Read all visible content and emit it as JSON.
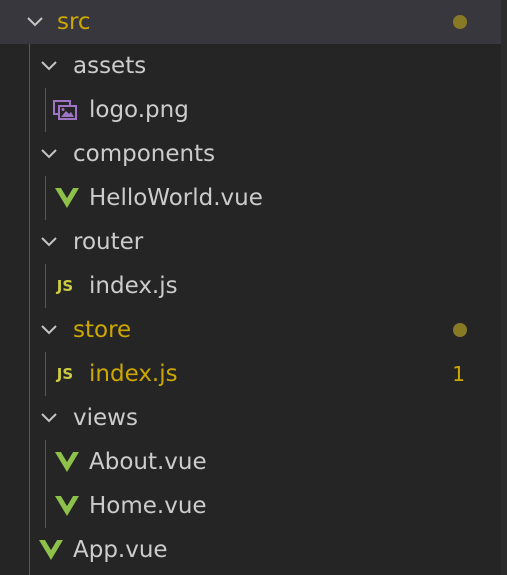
{
  "explorer": {
    "items": [
      {
        "label": "src",
        "type": "folder",
        "depth": 0,
        "modified": true,
        "badge": "",
        "icon": "chevron-down-icon"
      },
      {
        "label": "assets",
        "type": "folder",
        "depth": 1,
        "modified": false,
        "badge": "",
        "icon": "chevron-down-icon"
      },
      {
        "label": "logo.png",
        "type": "file",
        "depth": 2,
        "modified": false,
        "badge": "",
        "icon": "image-file-icon"
      },
      {
        "label": "components",
        "type": "folder",
        "depth": 1,
        "modified": false,
        "badge": "",
        "icon": "chevron-down-icon"
      },
      {
        "label": "HelloWorld.vue",
        "type": "file",
        "depth": 2,
        "modified": false,
        "badge": "",
        "icon": "vue-file-icon"
      },
      {
        "label": "router",
        "type": "folder",
        "depth": 1,
        "modified": false,
        "badge": "",
        "icon": "chevron-down-icon"
      },
      {
        "label": "index.js",
        "type": "file",
        "depth": 2,
        "modified": false,
        "badge": "",
        "icon": "js-file-icon"
      },
      {
        "label": "store",
        "type": "folder",
        "depth": 1,
        "modified": true,
        "badge": "",
        "icon": "chevron-down-icon"
      },
      {
        "label": "index.js",
        "type": "file",
        "depth": 2,
        "modified": true,
        "badge": "1",
        "icon": "js-file-icon"
      },
      {
        "label": "views",
        "type": "folder",
        "depth": 1,
        "modified": false,
        "badge": "",
        "icon": "chevron-down-icon"
      },
      {
        "label": "About.vue",
        "type": "file",
        "depth": 2,
        "modified": false,
        "badge": "",
        "icon": "vue-file-icon"
      },
      {
        "label": "Home.vue",
        "type": "file",
        "depth": 2,
        "modified": false,
        "badge": "",
        "icon": "vue-file-icon"
      },
      {
        "label": "App.vue",
        "type": "file",
        "depth": 1,
        "modified": false,
        "badge": "",
        "icon": "vue-file-icon"
      }
    ],
    "js_icon_text": "JS"
  },
  "colors": {
    "background": "#252526",
    "active_row": "#37373d",
    "text": "#cccccc",
    "modified_text": "#cca700",
    "modified_dot": "#887a25",
    "vue_green": "#8dc149",
    "js_yellow": "#cbcb41",
    "image_purple": "#a074c4"
  }
}
